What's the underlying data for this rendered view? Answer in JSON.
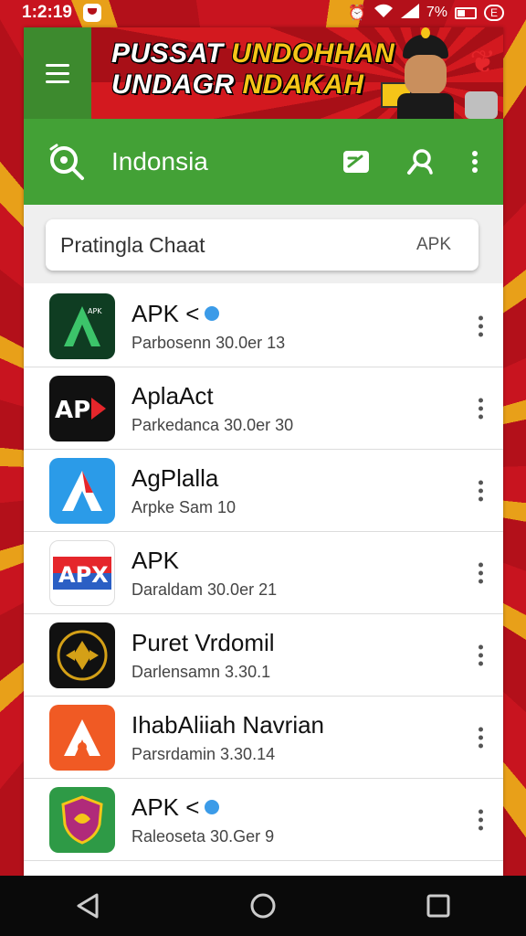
{
  "status_bar": {
    "time": "1:2:19",
    "battery_text": "7%",
    "pill_text": "E"
  },
  "banner": {
    "line1_white": "PUSSAT ",
    "line1_yellow": "UNDOHHAN",
    "line2_white": "UNDAGR ",
    "line2_yellow": "NDAKAH"
  },
  "appbar": {
    "title": "Indonsia"
  },
  "search": {
    "query": "Pratingla Chaat",
    "tag": "APK"
  },
  "apps": [
    {
      "name": "APK <",
      "sub": "Parbosenn 30.0er 13",
      "verified": true,
      "icon": "green-a-icon",
      "bg": "#0f3d22"
    },
    {
      "name": "AplaAct",
      "sub": "Parkedanca 30.0er 30",
      "verified": false,
      "icon": "apk-black-icon",
      "bg": "#111111"
    },
    {
      "name": "AgPlalla",
      "sub": "Arpke Sam 10",
      "verified": false,
      "icon": "blue-a-icon",
      "bg": "#2b9be8"
    },
    {
      "name": "APK",
      "sub": "Daraldam 30.0er 21",
      "verified": false,
      "icon": "apk-flag-icon",
      "bg": "#ffffff"
    },
    {
      "name": "Puret Vrdomil",
      "sub": "Darlensamn 3.30.1",
      "verified": false,
      "icon": "gold-emblem-icon",
      "bg": "#111111"
    },
    {
      "name": "IhabAliiah Navrian",
      "sub": "Parsrdamin 3.30.14",
      "verified": false,
      "icon": "orange-a-icon",
      "bg": "#f05a24"
    },
    {
      "name": "APK <",
      "sub": "Raleoseta 30.Ger 9",
      "verified": true,
      "icon": "shield-icon",
      "bg": "#2e9a46"
    }
  ]
}
